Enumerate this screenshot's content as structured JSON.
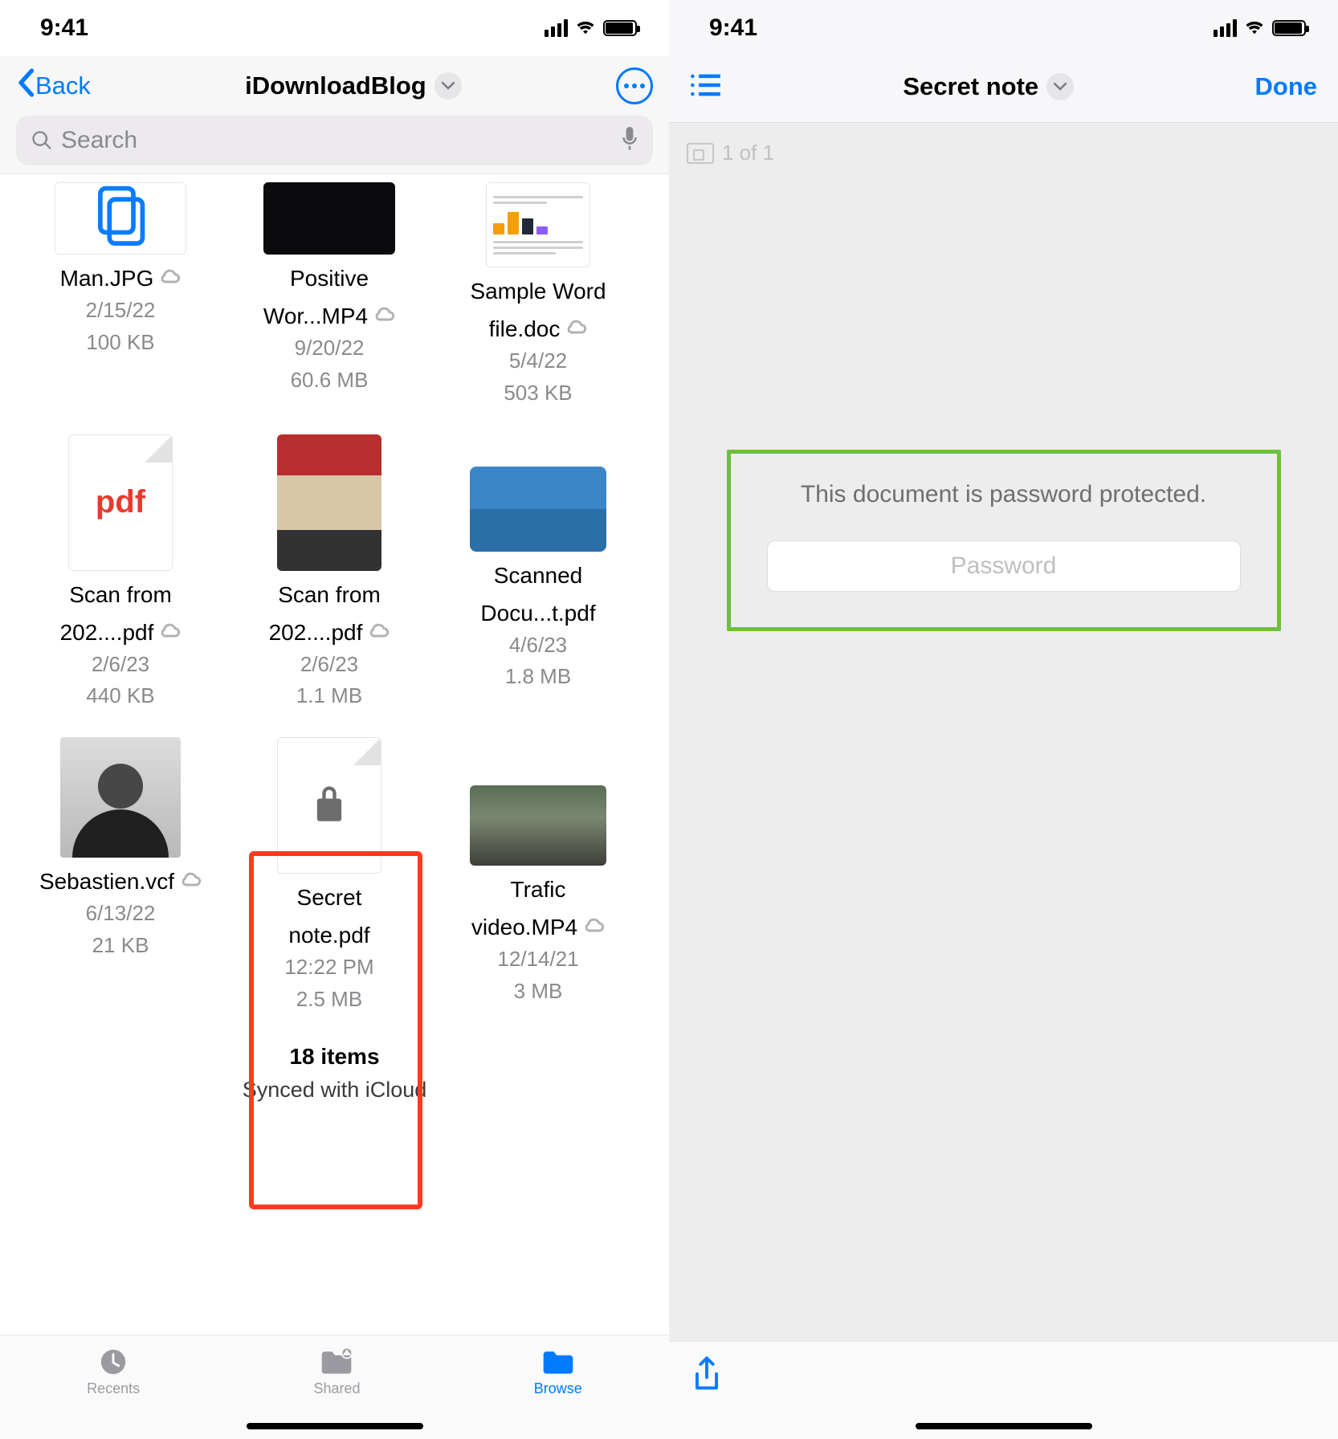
{
  "status": {
    "time": "9:41"
  },
  "left": {
    "nav": {
      "back": "Back",
      "title": "iDownloadBlog"
    },
    "search": {
      "placeholder": "Search"
    },
    "files": [
      {
        "name1": "Man.JPG",
        "date": "2/15/22",
        "size": "100 KB",
        "cloud": true,
        "thumbType": "copy"
      },
      {
        "name1": "Positive",
        "name2": "Wor...MP4",
        "date": "9/20/22",
        "size": "60.6 MB",
        "cloud": true,
        "thumbType": "black"
      },
      {
        "name1": "Sample Word",
        "name2": "file.doc",
        "date": "5/4/22",
        "size": "503 KB",
        "cloud": true,
        "thumbType": "doc"
      },
      {
        "name1": "Scan from",
        "name2": "202....pdf",
        "date": "2/6/23",
        "size": "440 KB",
        "cloud": true,
        "thumbType": "pdf"
      },
      {
        "name1": "Scan from",
        "name2": "202....pdf",
        "date": "2/6/23",
        "size": "1.1 MB",
        "cloud": true,
        "thumbType": "photo1"
      },
      {
        "name1": "Scanned",
        "name2": "Docu...t.pdf",
        "date": "4/6/23",
        "size": "1.8 MB",
        "cloud": false,
        "thumbType": "card"
      },
      {
        "name1": "Sebastien.vcf",
        "date": "6/13/22",
        "size": "21 KB",
        "cloud": true,
        "thumbType": "portrait"
      },
      {
        "name1": "Secret",
        "name2": "note.pdf",
        "date": "12:22 PM",
        "size": "2.5 MB",
        "cloud": false,
        "thumbType": "lock"
      },
      {
        "name1": "Trafic",
        "name2": "video.MP4",
        "date": "12/14/21",
        "size": "3 MB",
        "cloud": true,
        "thumbType": "aerial"
      }
    ],
    "footer": {
      "count": "18 items",
      "sync": "Synced with iCloud"
    },
    "tabs": {
      "recents": "Recents",
      "shared": "Shared",
      "browse": "Browse"
    }
  },
  "right": {
    "nav": {
      "title": "Secret note",
      "done": "Done"
    },
    "pageCount": "1 of 1",
    "pw": {
      "message": "This document is password protected.",
      "placeholder": "Password"
    }
  }
}
